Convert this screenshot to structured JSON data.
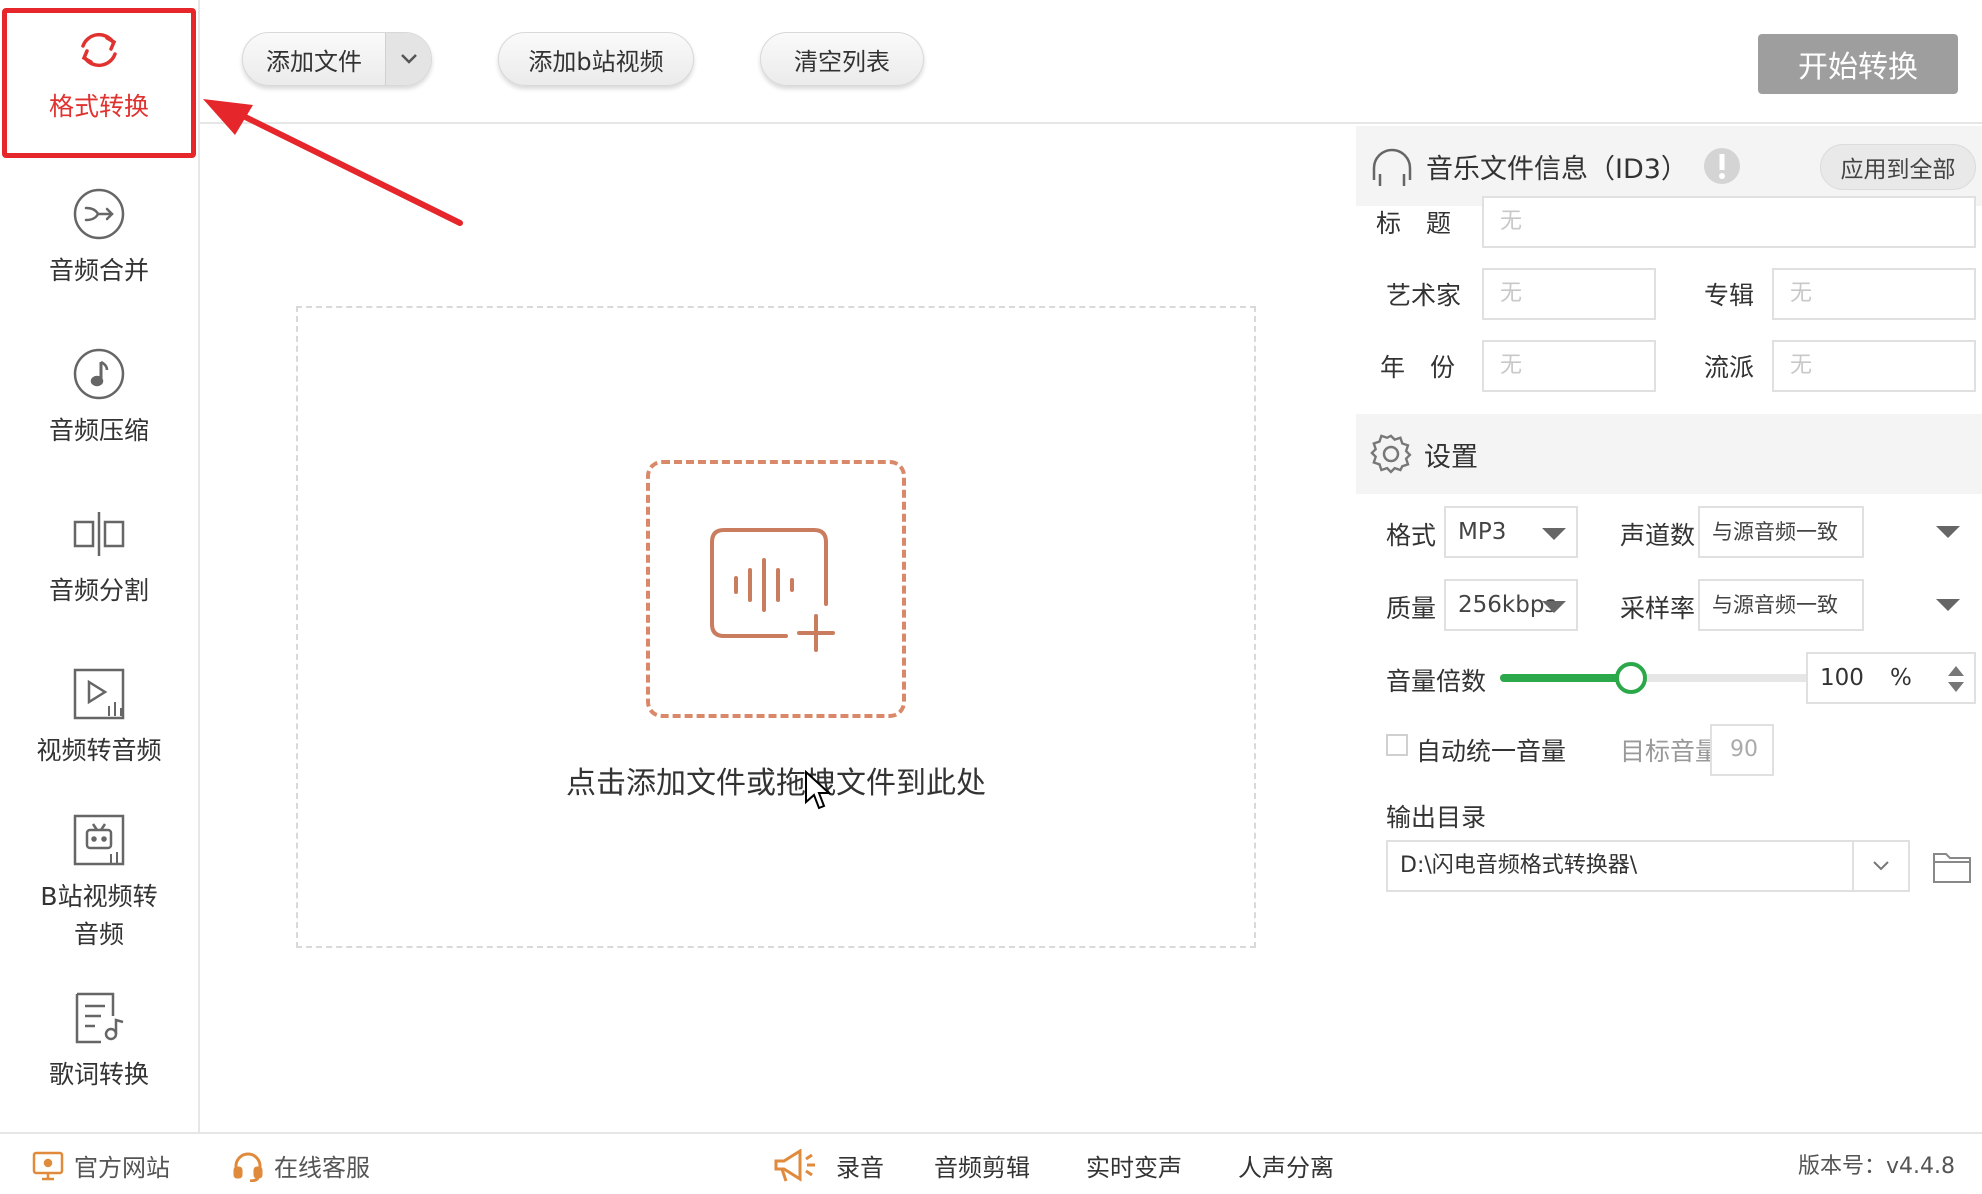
{
  "sidebar": {
    "items": [
      {
        "label": "格式转换",
        "icon": "refresh-icon"
      },
      {
        "label": "音频合并",
        "icon": "merge-icon"
      },
      {
        "label": "音频压缩",
        "icon": "music-note-icon"
      },
      {
        "label": "音频分割",
        "icon": "split-icon"
      },
      {
        "label": "视频转音频",
        "icon": "video-icon"
      },
      {
        "label": "B站视频转音频",
        "icon": "bilibili-icon"
      },
      {
        "label": "歌词转换",
        "icon": "lyrics-icon"
      }
    ],
    "active_index": 0
  },
  "toolbar": {
    "add_file": "添加文件",
    "add_bilibili": "添加b站视频",
    "clear_list": "清空列表",
    "start": "开始转换"
  },
  "dropzone": {
    "text": "点击添加文件或拖拽文件到此处"
  },
  "id3": {
    "title": "音乐文件信息（ID3）",
    "apply_all": "应用到全部",
    "fields": {
      "title_label": "标　题",
      "artist_label": "艺术家",
      "album_label": "专辑",
      "year_label": "年　份",
      "genre_label": "流派",
      "placeholder": "无"
    }
  },
  "settings": {
    "title": "设置",
    "format_label": "格式",
    "format_value": "MP3",
    "channels_label": "声道数",
    "channels_value": "与源音频一致",
    "quality_label": "质量",
    "quality_value": "256kbps",
    "samplerate_label": "采样率",
    "samplerate_value": "与源音频一致",
    "volume_label": "音量倍数",
    "volume_value": "100",
    "volume_unit": "%",
    "volume_fraction": 0.4,
    "auto_volume_label": "自动统一音量",
    "auto_volume_checked": false,
    "target_volume_label": "目标音量",
    "target_volume_value": "90",
    "output_label": "输出目录",
    "output_path": "D:\\闪电音频格式转换器\\"
  },
  "footer": {
    "website": "官方网站",
    "support": "在线客服",
    "record": "录音",
    "audio_edit": "音频剪辑",
    "voice_change": "实时变声",
    "vocal_separation": "人声分离",
    "version": "版本号：v4.4.8"
  },
  "colors": {
    "accent_red": "#e5262b",
    "slider_green": "#2aa84a",
    "drop_border": "#d9896a"
  }
}
